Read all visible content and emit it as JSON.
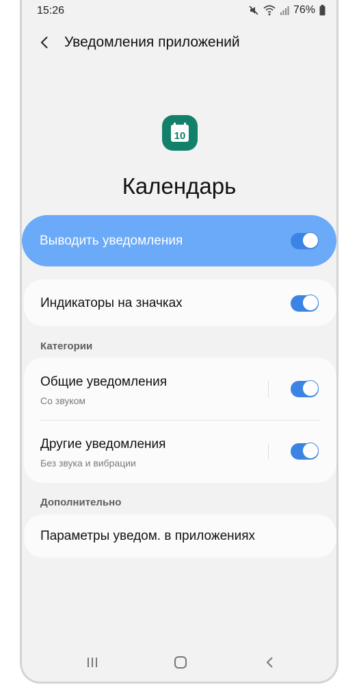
{
  "status": {
    "time": "15:26",
    "battery": "76%"
  },
  "header": {
    "title": "Уведомления приложений"
  },
  "app": {
    "icon_number": "10",
    "name": "Календарь"
  },
  "rows": {
    "show_notifications": {
      "label": "Выводить уведомления",
      "enabled": true
    },
    "badges": {
      "label": "Индикаторы на значках",
      "enabled": true
    },
    "general": {
      "label": "Общие уведомления",
      "sub": "Со звуком",
      "enabled": true
    },
    "other": {
      "label": "Другие уведомления",
      "sub": "Без звука и вибрации",
      "enabled": true
    },
    "app_settings": {
      "label": "Параметры уведом. в приложениях"
    }
  },
  "sections": {
    "categories": "Категории",
    "advanced": "Дополнительно"
  },
  "colors": {
    "accent": "#3b84e4",
    "highlight": "#6aaaf8",
    "app_icon": "#13806a",
    "background": "#f2f2f2"
  },
  "icons": [
    "mute-icon",
    "wifi-icon",
    "signal-icon",
    "battery-icon",
    "back-arrow-icon",
    "calendar-icon",
    "recents-icon",
    "home-icon",
    "nav-back-icon"
  ]
}
